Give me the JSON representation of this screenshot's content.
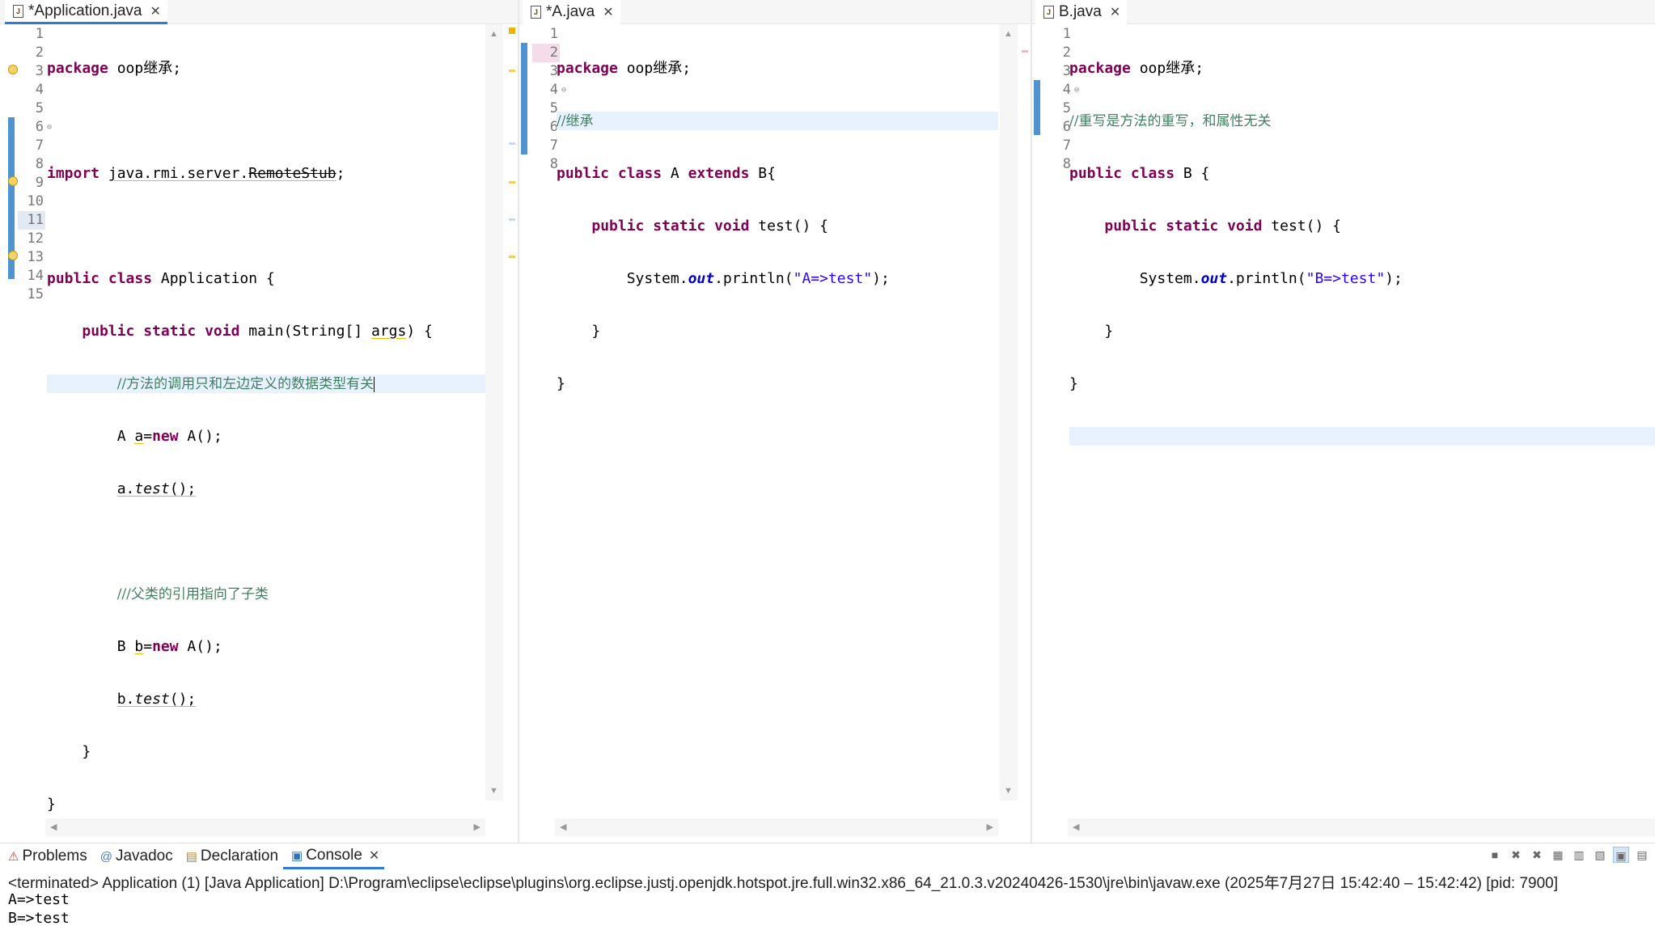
{
  "editors": {
    "application": {
      "tab_label": "*Application.java",
      "lines": [
        {
          "n": "1"
        },
        {
          "n": "2"
        },
        {
          "n": "3"
        },
        {
          "n": "4"
        },
        {
          "n": "5"
        },
        {
          "n": "6"
        },
        {
          "n": "7"
        },
        {
          "n": "8"
        },
        {
          "n": "9"
        },
        {
          "n": "10"
        },
        {
          "n": "11"
        },
        {
          "n": "12"
        },
        {
          "n": "13"
        },
        {
          "n": "14"
        },
        {
          "n": "15"
        }
      ],
      "code": {
        "l1_kw": "package",
        "l1_rest": " oop继承;",
        "l3_kw": "import",
        "l3_pkg": "java.rmi.server.",
        "l3_cls": "RemoteStub",
        "l3_end": ";",
        "l5_kw": "public class",
        "l5_rest": " Application {",
        "l6_kw": "public static void",
        "l6_rest1": " main(String[] ",
        "l6_args": "args",
        "l6_rest2": ") {",
        "l7_cm": "//方法的调用只和左边定义的数据类型有关",
        "l8_a": "A ",
        "l8_var": "a",
        "l8_eq": "=",
        "l8_kw": "new",
        "l8_rest": " A();",
        "l9_var": "a",
        "l9_dot": ".",
        "l9_call": "test",
        "l9_end": "();",
        "l11_cm": "///父类的引用指向了子类",
        "l12_a": "B ",
        "l12_var": "b",
        "l12_eq": "=",
        "l12_kw": "new",
        "l12_rest": " A();",
        "l13_var": "b",
        "l13_dot": ".",
        "l13_call": "test",
        "l13_end": "();",
        "l14": "}",
        "l15": "}"
      }
    },
    "a": {
      "tab_label": "*A.java",
      "lines": [
        {
          "n": "1"
        },
        {
          "n": "2"
        },
        {
          "n": "3"
        },
        {
          "n": "4"
        },
        {
          "n": "5"
        },
        {
          "n": "6"
        },
        {
          "n": "7"
        },
        {
          "n": "8"
        }
      ],
      "code": {
        "l1_kw": "package",
        "l1_rest": " oop继承;",
        "l2_cm": "//继承",
        "l3_kw1": "public class",
        "l3_mid": " A ",
        "l3_kw2": "extends",
        "l3_rest": " B{",
        "l4_kw": "public static void",
        "l4_rest": " test() {",
        "l5_pre": "System.",
        "l5_fld": "out",
        "l5_mid": ".println(",
        "l5_str": "\"A=>test\"",
        "l5_end": ");",
        "l6": "}",
        "l7": "}"
      }
    },
    "b": {
      "tab_label": "B.java",
      "lines": [
        {
          "n": "1"
        },
        {
          "n": "2"
        },
        {
          "n": "3"
        },
        {
          "n": "4"
        },
        {
          "n": "5"
        },
        {
          "n": "6"
        },
        {
          "n": "7"
        },
        {
          "n": "8"
        }
      ],
      "code": {
        "l1_kw": "package",
        "l1_rest": " oop继承;",
        "l2_cm": "//重写是方法的重写，和属性无关",
        "l3_kw": "public class",
        "l3_rest": " B {",
        "l4_kw": "public static void",
        "l4_rest": " test() {",
        "l5_pre": "System.",
        "l5_fld": "out",
        "l5_mid": ".println(",
        "l5_str": "\"B=>test\"",
        "l5_end": ");",
        "l6": "}",
        "l7": "}"
      }
    }
  },
  "views": {
    "tabs": [
      "Problems",
      "Javadoc",
      "Declaration",
      "Console"
    ],
    "active": "Console",
    "console_header": "<terminated> Application (1) [Java Application] D:\\Program\\eclipse\\eclipse\\plugins\\org.eclipse.justj.openjdk.hotspot.jre.full.win32.x86_64_21.0.3.v20240426-1530\\jre\\bin\\javaw.exe  (2025年7月27日 15:42:40 – 15:42:42) [pid: 7900]",
    "output": [
      "A=>test",
      "B=>test"
    ]
  },
  "colors": {
    "keyword": "#7f0055",
    "comment": "#3f7f5f",
    "string": "#2a00ff",
    "field": "#0000c0",
    "active_tab_underline": "#2f7bd6",
    "current_line": "#e8f2fe"
  },
  "icons": [
    "java-file-icon",
    "close-icon",
    "problems-icon",
    "javadoc-icon",
    "declaration-icon",
    "console-icon",
    "lightbulb-warning-icon",
    "fold-icon"
  ]
}
